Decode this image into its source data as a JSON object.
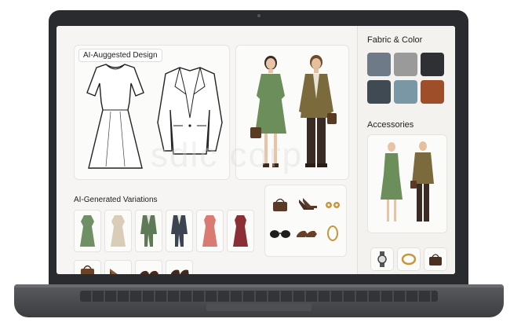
{
  "main": {
    "suggested_title": "AI-Auggested Design",
    "variations_title": "AI-Generated Variations",
    "sketches": [
      "dress-sketch",
      "blazer-sketch"
    ],
    "models": [
      "woman-in-green-dress",
      "man-in-olive-blazer"
    ],
    "variations": [
      {
        "item": "green-dress",
        "color": "#6f8f65"
      },
      {
        "item": "beige-dress",
        "color": "#d9cdb8"
      },
      {
        "item": "green-suit",
        "color": "#5f7a56"
      },
      {
        "item": "navy-suit",
        "color": "#3b4450"
      },
      {
        "item": "coral-dress",
        "color": "#d97b72"
      },
      {
        "item": "burgundy-dress",
        "color": "#8c2f35"
      }
    ],
    "small_items": [
      "brown-handbag",
      "brown-heels",
      "brown-loafers",
      "brown-mules"
    ],
    "accessory_items": [
      "handbag",
      "heels",
      "earrings",
      "sunglasses",
      "loafers",
      "bracelet"
    ]
  },
  "sidebar": {
    "fabric_title": "Fabric & Color",
    "swatches": [
      "#6e7a88",
      "#9a9a9a",
      "#2e3033",
      "#3f4a52",
      "#7a97a6",
      "#9e4f2a"
    ],
    "accessories_title": "Accessories",
    "accessory_icons": [
      "watch-icon",
      "bracelet-icon",
      "handbag-icon"
    ]
  },
  "watermark": "sdlc corp"
}
